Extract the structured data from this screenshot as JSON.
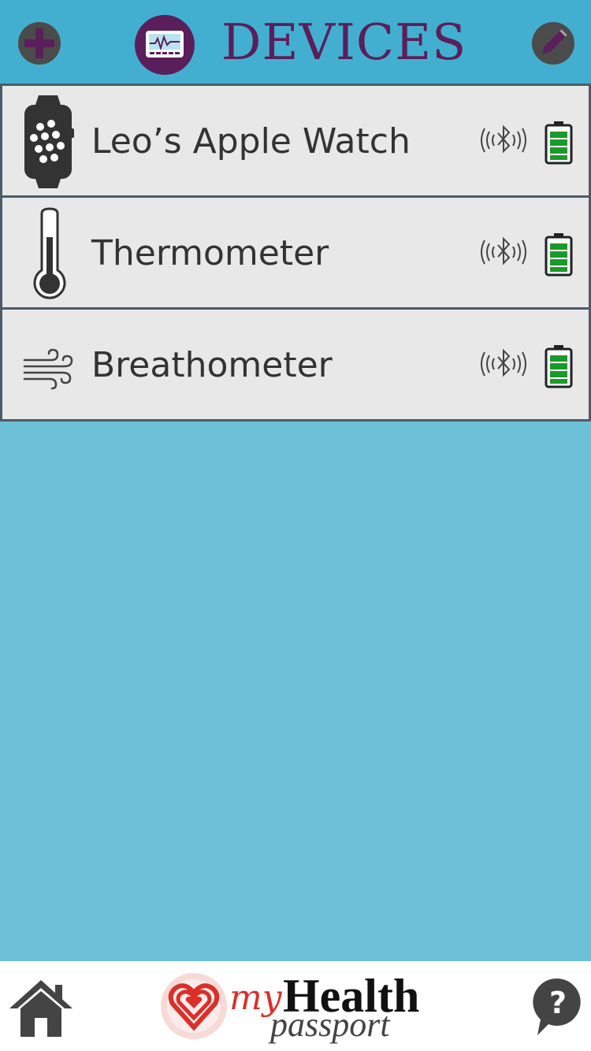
{
  "header": {
    "title": "DEVICES",
    "add_icon": "plus-icon",
    "edit_icon": "pencil-icon",
    "title_icon": "heart-monitor-icon"
  },
  "devices": [
    {
      "name": "Leo’s Apple Watch",
      "icon": "smartwatch-icon",
      "connection": "bluetooth-icon",
      "battery": 1.0
    },
    {
      "name": "Thermometer",
      "icon": "thermometer-icon",
      "connection": "bluetooth-icon",
      "battery": 1.0
    },
    {
      "name": "Breathometer",
      "icon": "wind-icon",
      "connection": "bluetooth-icon",
      "battery": 1.0
    }
  ],
  "footer": {
    "home_icon": "home-icon",
    "help_icon": "help-icon",
    "logo": {
      "my": "my",
      "health": "Health",
      "passport": "passport"
    }
  },
  "colors": {
    "header_bg": "#43afd0",
    "page_bg": "#6cc0d7",
    "accent_purple": "#5a1f5a",
    "row_bg": "#e8e8e8",
    "row_border": "#4a5d68",
    "battery_green": "#1a9a2a",
    "logo_red": "#d9302a"
  }
}
